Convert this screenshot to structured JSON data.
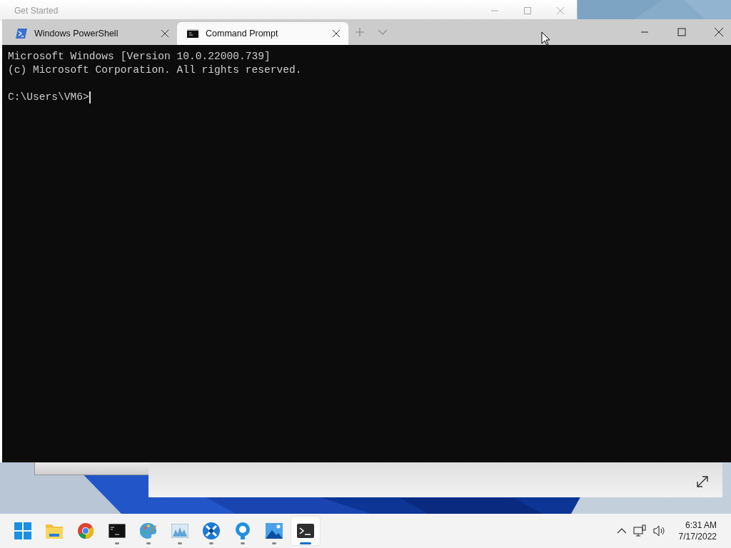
{
  "background_window": {
    "title": "Get Started"
  },
  "terminal": {
    "tabs": [
      {
        "label": "Windows PowerShell",
        "selected": false,
        "kind": "powershell"
      },
      {
        "label": "Command Prompt",
        "selected": true,
        "kind": "cmd"
      }
    ],
    "output": [
      "Microsoft Windows [Version 10.0.22000.739]",
      "(c) Microsoft Corporation. All rights reserved."
    ],
    "prompt": "C:\\Users\\VM6>"
  },
  "taskbar": {
    "apps": [
      {
        "kind": "start",
        "running": false,
        "selected": false
      },
      {
        "kind": "folder",
        "running": false,
        "selected": false
      },
      {
        "kind": "chrome",
        "running": false,
        "selected": false
      },
      {
        "kind": "console",
        "running": true,
        "selected": false
      },
      {
        "kind": "paint",
        "running": true,
        "selected": false
      },
      {
        "kind": "monitor",
        "running": true,
        "selected": false
      },
      {
        "kind": "tool",
        "running": true,
        "selected": false
      },
      {
        "kind": "bulb",
        "running": true,
        "selected": false
      },
      {
        "kind": "photos",
        "running": true,
        "selected": false
      },
      {
        "kind": "terminal",
        "running": true,
        "selected": true
      }
    ],
    "time": "6:31 AM",
    "date": "7/17/2022"
  }
}
